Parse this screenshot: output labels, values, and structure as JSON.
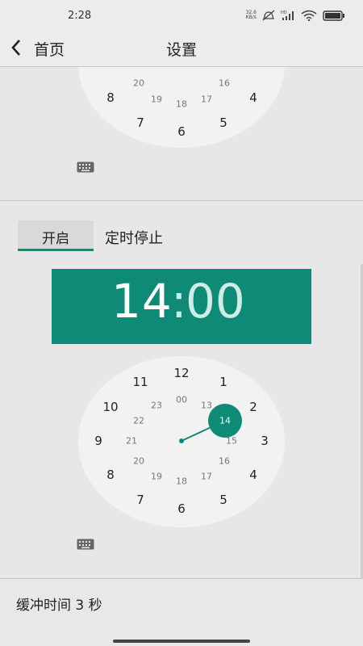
{
  "status_bar": {
    "time": "2:28",
    "net_speed_value": "32.6",
    "net_speed_unit": "KB/s",
    "icons": [
      "net-speed-icon",
      "mute-icon",
      "hd-signal-icon",
      "signal-icon",
      "wifi-icon",
      "battery-icon"
    ]
  },
  "app_bar": {
    "back_label": "首页",
    "title": "设置"
  },
  "clock_partial": {
    "outer": [
      "8",
      "7",
      "6",
      "5",
      "4"
    ],
    "inner": [
      "20",
      "19",
      "18",
      "17",
      "16"
    ]
  },
  "timer": {
    "toggle_label": "开启",
    "label": "定时停止",
    "hour": "14",
    "colon": ":",
    "minute": "00",
    "selected_hour": "14",
    "accent_color": "#0f8a76",
    "clock_outer": [
      "12",
      "1",
      "2",
      "3",
      "4",
      "5",
      "6",
      "7",
      "8",
      "9",
      "10",
      "11"
    ],
    "clock_inner": [
      "00",
      "13",
      "14",
      "15",
      "16",
      "17",
      "18",
      "19",
      "20",
      "21",
      "22",
      "23"
    ]
  },
  "buffer": {
    "label": "缓冲时间 3 秒"
  }
}
